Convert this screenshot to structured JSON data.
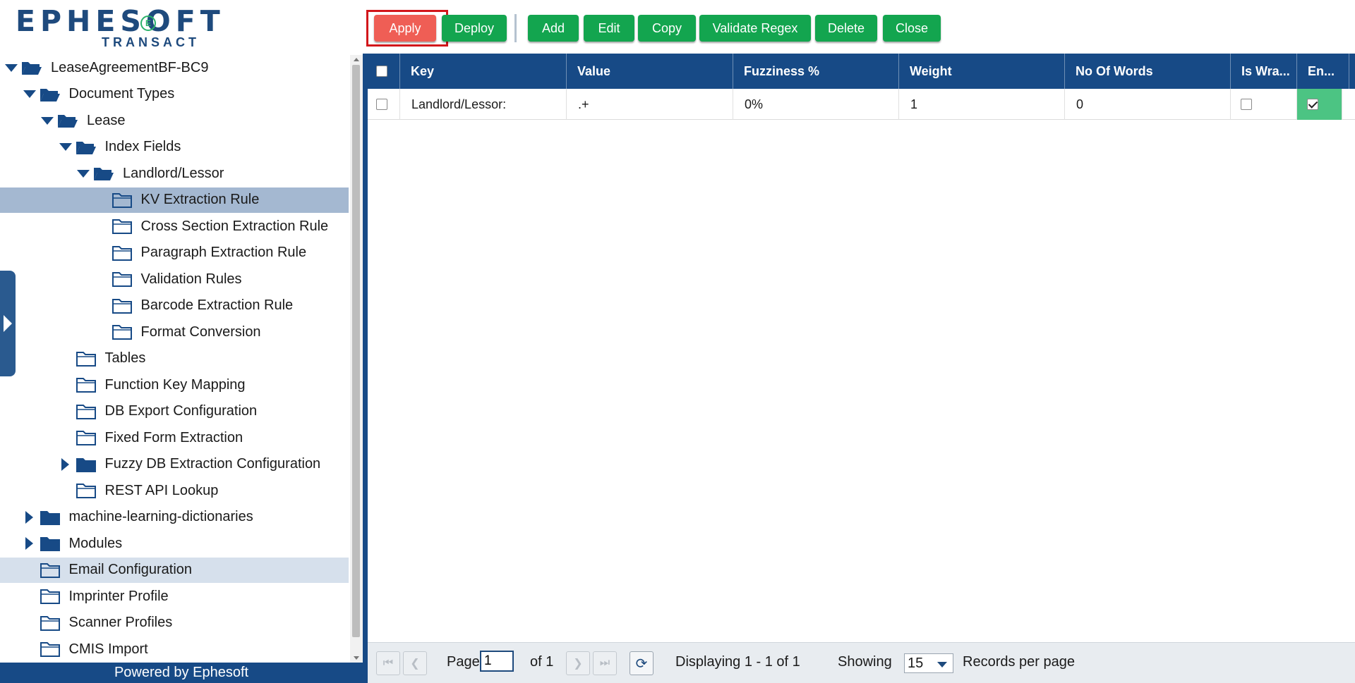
{
  "brand": {
    "name": "EPHESOFT",
    "sub": "TRANSACT",
    "mark": "E"
  },
  "tree": {
    "items": [
      {
        "label": "LeaseAgreementBF-BC9",
        "level": 0,
        "expander": "down",
        "icon": "folder-open-icon"
      },
      {
        "label": "Document Types",
        "level": 1,
        "expander": "down",
        "icon": "folder-open-icon"
      },
      {
        "label": "Lease",
        "level": 2,
        "expander": "down",
        "icon": "folder-open-icon"
      },
      {
        "label": "Index Fields",
        "level": 3,
        "expander": "down",
        "icon": "folder-open-icon"
      },
      {
        "label": "Landlord/Lessor",
        "level": 4,
        "expander": "down",
        "icon": "folder-open-icon"
      },
      {
        "label": "KV Extraction Rule",
        "level": 5,
        "expander": "none",
        "icon": "folder-outline-icon",
        "state": "selected"
      },
      {
        "label": "Cross Section Extraction Rule",
        "level": 5,
        "expander": "none",
        "icon": "folder-outline-icon"
      },
      {
        "label": "Paragraph Extraction Rule",
        "level": 5,
        "expander": "none",
        "icon": "folder-outline-icon"
      },
      {
        "label": "Validation Rules",
        "level": 5,
        "expander": "none",
        "icon": "folder-outline-icon"
      },
      {
        "label": "Barcode Extraction Rule",
        "level": 5,
        "expander": "none",
        "icon": "folder-outline-icon"
      },
      {
        "label": "Format Conversion",
        "level": 5,
        "expander": "none",
        "icon": "folder-outline-icon"
      },
      {
        "label": "Tables",
        "level": 3,
        "expander": "none",
        "icon": "folder-outline-icon"
      },
      {
        "label": "Function Key Mapping",
        "level": 3,
        "expander": "none",
        "icon": "folder-outline-icon"
      },
      {
        "label": "DB Export Configuration",
        "level": 3,
        "expander": "none",
        "icon": "folder-outline-icon"
      },
      {
        "label": "Fixed Form Extraction",
        "level": 3,
        "expander": "none",
        "icon": "folder-outline-icon"
      },
      {
        "label": "Fuzzy DB Extraction Configuration",
        "level": 3,
        "expander": "right",
        "icon": "folder-filled-icon"
      },
      {
        "label": "REST API Lookup",
        "level": 3,
        "expander": "none",
        "icon": "folder-outline-icon"
      },
      {
        "label": "machine-learning-dictionaries",
        "level": 1,
        "expander": "right",
        "icon": "folder-filled-icon"
      },
      {
        "label": "Modules",
        "level": 1,
        "expander": "right",
        "icon": "folder-filled-icon"
      },
      {
        "label": "Email Configuration",
        "level": 1,
        "expander": "none",
        "icon": "folder-outline-icon",
        "state": "highlight"
      },
      {
        "label": "Imprinter Profile",
        "level": 1,
        "expander": "none",
        "icon": "folder-outline-icon"
      },
      {
        "label": "Scanner Profiles",
        "level": 1,
        "expander": "none",
        "icon": "folder-outline-icon"
      },
      {
        "label": "CMIS Import",
        "level": 1,
        "expander": "none",
        "icon": "folder-outline-icon"
      }
    ]
  },
  "footer": {
    "powered_by": "Powered by Ephesoft"
  },
  "toolbar": {
    "apply": "Apply",
    "deploy": "Deploy",
    "add": "Add",
    "edit": "Edit",
    "copy": "Copy",
    "validate_regex": "Validate Regex",
    "delete": "Delete",
    "close": "Close"
  },
  "grid": {
    "columns": [
      "Key",
      "Value",
      "Fuzziness %",
      "Weight",
      "No Of Words",
      "Is Wra...",
      "En..."
    ],
    "rows": [
      {
        "key": "Landlord/Lessor:",
        "value": ".+",
        "fuzziness": "0%",
        "weight": "1",
        "no_of_words": "0",
        "is_wrapped": false,
        "enabled": true
      }
    ]
  },
  "pager": {
    "page_label": "Page",
    "page_value": "1",
    "of_label": "of 1",
    "displaying": "Displaying 1 - 1 of 1",
    "showing_label": "Showing",
    "records_value": "15",
    "records_label": "Records per page"
  },
  "colors": {
    "navy": "#174a86",
    "green_button": "#13a54f",
    "apply_button": "#ef5e55",
    "apply_highlight": "#d2161b",
    "selected_row": "#a4b8d1",
    "enabled_cell": "#4cc483"
  }
}
